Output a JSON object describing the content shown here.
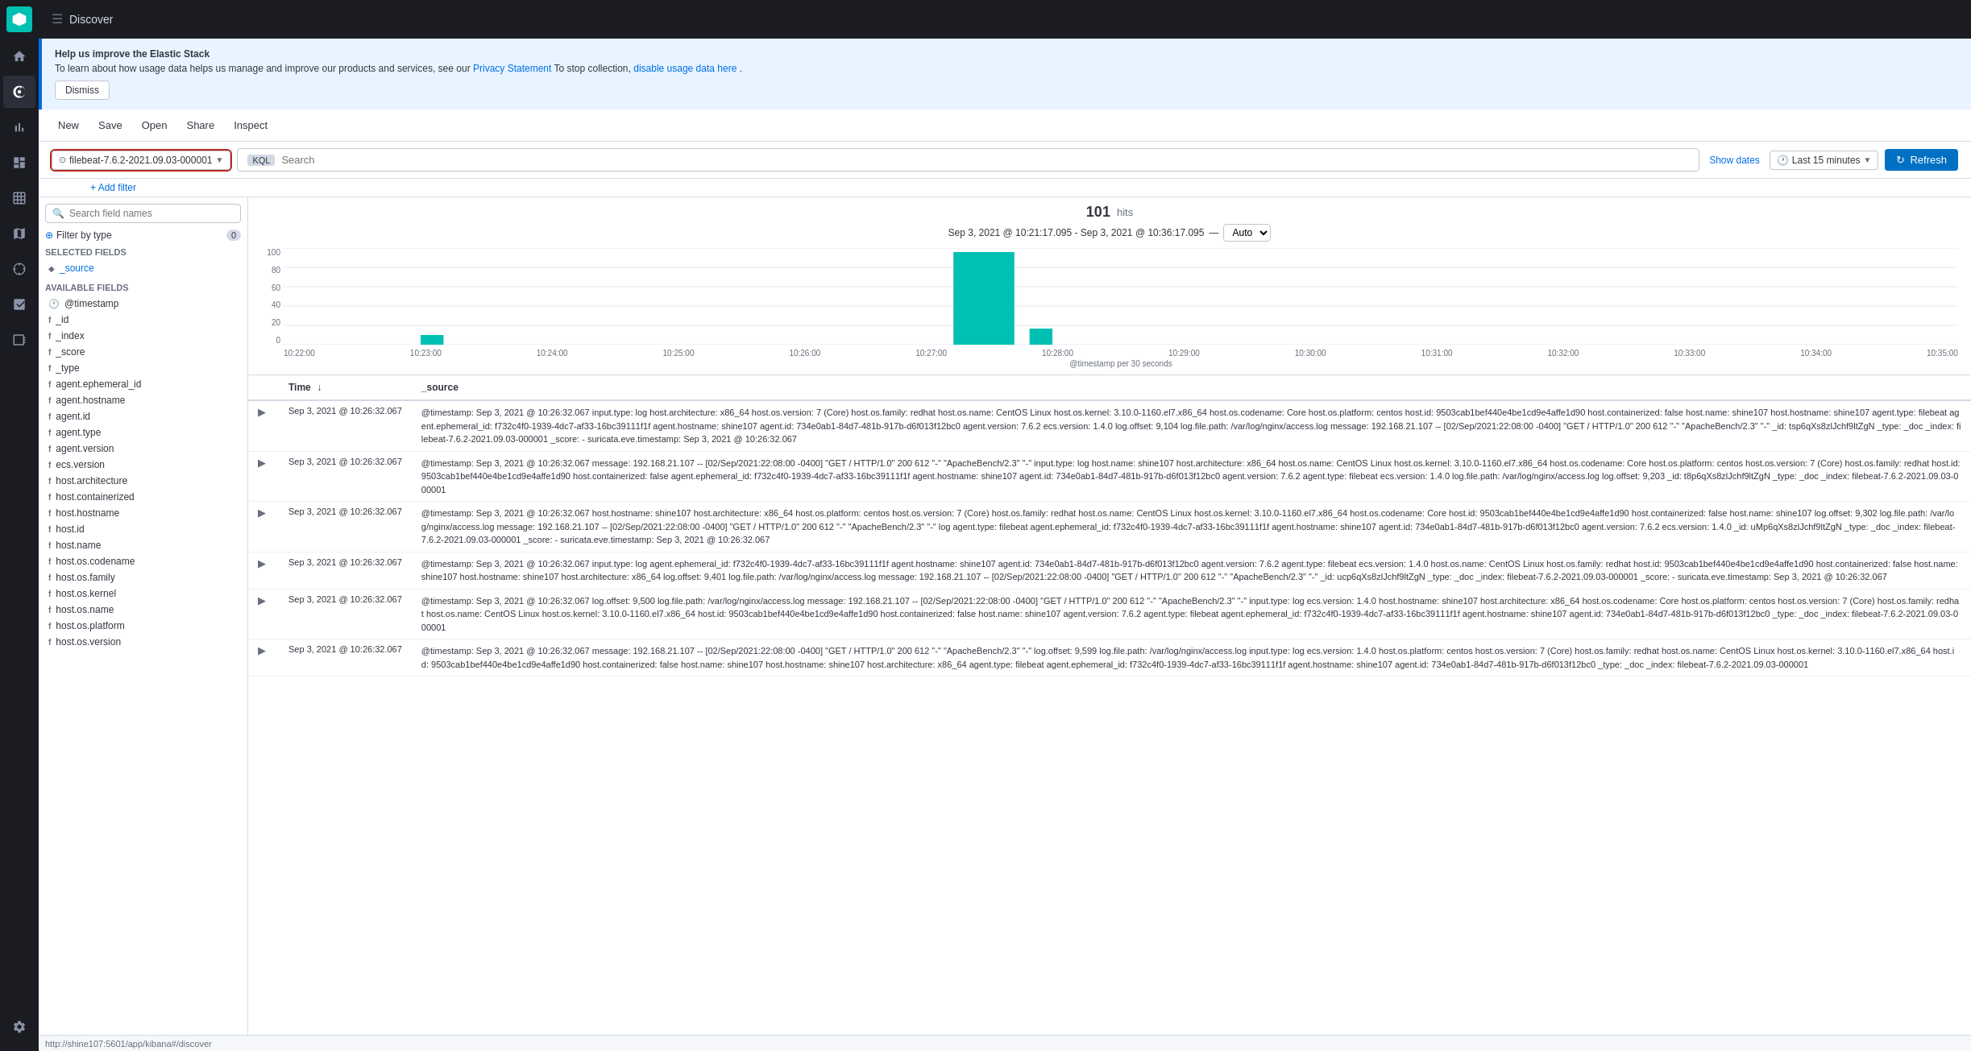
{
  "app": {
    "title": "Discover",
    "logo_text": "K"
  },
  "sidebar": {
    "items": [
      {
        "id": "home",
        "icon": "home",
        "label": "Home"
      },
      {
        "id": "discover",
        "icon": "discover",
        "label": "Discover",
        "active": true
      },
      {
        "id": "visualize",
        "icon": "visualize",
        "label": "Visualize"
      },
      {
        "id": "dashboard",
        "icon": "dashboard",
        "label": "Dashboard"
      },
      {
        "id": "canvas",
        "icon": "canvas",
        "label": "Canvas"
      },
      {
        "id": "maps",
        "icon": "maps",
        "label": "Maps"
      },
      {
        "id": "ml",
        "icon": "ml",
        "label": "Machine Learning"
      },
      {
        "id": "monitoring",
        "icon": "monitoring",
        "label": "Monitoring"
      },
      {
        "id": "settings",
        "icon": "settings",
        "label": "Settings"
      }
    ]
  },
  "banner": {
    "title": "Help us improve the Elastic Stack",
    "text": "To learn about how usage data helps us manage and improve our products and services, see our ",
    "privacy_link_text": "Privacy Statement",
    "stop_text": " To stop collection, ",
    "disable_link_text": "disable usage data here",
    "dismiss_label": "Dismiss"
  },
  "toolbar": {
    "new_label": "New",
    "save_label": "Save",
    "open_label": "Open",
    "share_label": "Share",
    "inspect_label": "Inspect"
  },
  "search": {
    "index_pattern": "filebeat-7.6.2-2021.09.03-000001",
    "placeholder": "Search",
    "kql_label": "KQL",
    "time_picker_label": "Last 15 minutes",
    "show_dates_label": "Show dates",
    "refresh_label": "Refresh",
    "add_filter_label": "+ Add filter"
  },
  "left_panel": {
    "search_placeholder": "Search field names",
    "filter_type_label": "Filter by type",
    "filter_count": "0",
    "selected_fields_title": "Selected fields",
    "available_fields_title": "Available fields",
    "selected_fields": [
      {
        "name": "_source",
        "type": "source"
      }
    ],
    "available_fields": [
      {
        "name": "@timestamp",
        "type": "calendar"
      },
      {
        "name": "_id",
        "type": "string"
      },
      {
        "name": "_index",
        "type": "string"
      },
      {
        "name": "_score",
        "type": "string"
      },
      {
        "name": "_type",
        "type": "string"
      },
      {
        "name": "agent.ephemeral_id",
        "type": "string"
      },
      {
        "name": "agent.hostname",
        "type": "string"
      },
      {
        "name": "agent.id",
        "type": "string"
      },
      {
        "name": "agent.type",
        "type": "string"
      },
      {
        "name": "agent.version",
        "type": "string"
      },
      {
        "name": "ecs.version",
        "type": "string"
      },
      {
        "name": "host.architecture",
        "type": "string"
      },
      {
        "name": "host.containerized",
        "type": "string"
      },
      {
        "name": "host.hostname",
        "type": "string"
      },
      {
        "name": "host.id",
        "type": "string"
      },
      {
        "name": "host.name",
        "type": "string"
      },
      {
        "name": "host.os.codename",
        "type": "string"
      },
      {
        "name": "host.os.family",
        "type": "string"
      },
      {
        "name": "host.os.kernel",
        "type": "string"
      },
      {
        "name": "host.os.name",
        "type": "string"
      },
      {
        "name": "host.os.platform",
        "type": "string"
      },
      {
        "name": "host.os.version",
        "type": "string"
      }
    ]
  },
  "chart": {
    "hits": "101",
    "hits_label": "hits",
    "date_range": "Sep 3, 2021 @ 10:21:17.095 - Sep 3, 2021 @ 10:36:17.095",
    "separator": "—",
    "auto_label": "Auto",
    "x_label": "@timestamp per 30 seconds",
    "y_axis": [
      "100",
      "80",
      "60",
      "40",
      "20",
      "0"
    ],
    "x_ticks": [
      "10:22:00",
      "10:23:00",
      "10:24:00",
      "10:25:00",
      "10:26:00",
      "10:27:00",
      "10:28:00",
      "10:29:00",
      "10:30:00",
      "10:31:00",
      "10:32:00",
      "10:33:00",
      "10:34:00",
      "10:35:00"
    ]
  },
  "table": {
    "col_time": "Time",
    "col_source": "_source",
    "rows": [
      {
        "time": "Sep 3, 2021 @ 10:26:32.067",
        "source": "@timestamp: Sep 3, 2021 @ 10:26:32.067 input.type: log host.architecture: x86_64 host.os.version: 7 (Core) host.os.family: redhat host.os.name: CentOS Linux host.os.kernel: 3.10.0-1160.el7.x86_64 host.os.codename: Core host.os.platform: centos host.id: 9503cab1bef440e4be1cd9e4affe1d90 host.containerized: false host.name: shine107 host.hostname: shine107 agent.type: filebeat agent.ephemeral_id: f732c4f0-1939-4dc7-af33-16bc39111f1f agent.hostname: shine107 agent.id: 734e0ab1-84d7-481b-917b-d6f013f12bc0 agent.version: 7.6.2 ecs.version: 1.4.0 log.offset: 9,104 log.file.path: /var/log/nginx/access.log message: 192.168.21.107 -- [02/Sep/2021:22:08:00 -0400] \"GET / HTTP/1.0\" 200 612 \"-\" \"ApacheBench/2.3\" \"-\" _id: tsp6qXs8zlJchf9ltZgN _type: _doc _index: filebeat-7.6.2-2021.09.03-000001 _score: - suricata.eve.timestamp: Sep 3, 2021 @ 10:26:32.067"
      },
      {
        "time": "Sep 3, 2021 @ 10:26:32.067",
        "source": "@timestamp: Sep 3, 2021 @ 10:26:32.067 message: 192.168.21.107 -- [02/Sep/2021:22:08:00 -0400] \"GET / HTTP/1.0\" 200 612 \"-\" \"ApacheBench/2.3\" \"-\" input.type: log host.name: shine107 host.architecture: x86_64 host.os.name: CentOS Linux host.os.kernel: 3.10.0-1160.el7.x86_64 host.os.codename: Core host.os.platform: centos host.os.version: 7 (Core) host.os.family: redhat host.id: 9503cab1bef440e4be1cd9e4affe1d90 host.containerized: false agent.ephemeral_id: f732c4f0-1939-4dc7-af33-16bc39111f1f agent.hostname: shine107 agent.id: 734e0ab1-84d7-481b-917b-d6f013f12bc0 agent.version: 7.6.2 agent.type: filebeat ecs.version: 1.4.0 log.file.path: /var/log/nginx/access.log log.offset: 9,203 _id: t8p6qXs8zlJchf9ltZgN _type: _doc _index: filebeat-7.6.2-2021.09.03-000001"
      },
      {
        "time": "Sep 3, 2021 @ 10:26:32.067",
        "source": "@timestamp: Sep 3, 2021 @ 10:26:32.067 host.hostname: shine107 host.architecture: x86_64 host.os.platform: centos host.os.version: 7 (Core) host.os.family: redhat host.os.name: CentOS Linux host.os.kernel: 3.10.0-1160.el7.x86_64 host.os.codename: Core host.id: 9503cab1bef440e4be1cd9e4affe1d90 host.containerized: false host.name: shine107 log.offset: 9,302 log.file.path: /var/log/nginx/access.log message: 192.168.21.107 -- [02/Sep/2021:22:08:00 -0400] \"GET / HTTP/1.0\" 200 612 \"-\" \"ApacheBench/2.3\" \"-\" log agent.type: filebeat agent.ephemeral_id: f732c4f0-1939-4dc7-af33-16bc39111f1f agent.hostname: shine107 agent.id: 734e0ab1-84d7-481b-917b-d6f013f12bc0 agent.version: 7.6.2 ecs.version: 1.4.0 _id: uMp6qXs8zlJchf9ltZgN _type: _doc _index: filebeat-7.6.2-2021.09.03-000001 _score: - suricata.eve.timestamp: Sep 3, 2021 @ 10:26:32.067"
      },
      {
        "time": "Sep 3, 2021 @ 10:26:32.067",
        "source": "@timestamp: Sep 3, 2021 @ 10:26:32.067 input.type: log agent.ephemeral_id: f732c4f0-1939-4dc7-af33-16bc39111f1f agent.hostname: shine107 agent.id: 734e0ab1-84d7-481b-917b-d6f013f12bc0 agent.version: 7.6.2 agent.type: filebeat ecs.version: 1.4.0 host.os.name: CentOS Linux host.os.family: redhat host.id: 9503cab1bef440e4be1cd9e4affe1d90 host.containerized: false host.name: shine107 host.hostname: shine107 host.architecture: x86_64 log.offset: 9,401 log.file.path: /var/log/nginx/access.log message: 192.168.21.107 -- [02/Sep/2021:22:08:00 -0400] \"GET / HTTP/1.0\" 200 612 \"-\" \"ApacheBench/2.3\" \"-\" _id: ucp6qXs8zlJchf9ltZgN _type: _doc _index: filebeat-7.6.2-2021.09.03-000001 _score: - suricata.eve.timestamp: Sep 3, 2021 @ 10:26:32.067"
      },
      {
        "time": "Sep 3, 2021 @ 10:26:32.067",
        "source": "@timestamp: Sep 3, 2021 @ 10:26:32.067 log.offset: 9,500 log.file.path: /var/log/nginx/access.log message: 192.168.21.107 -- [02/Sep/2021:22:08:00 -0400] \"GET / HTTP/1.0\" 200 612 \"-\" \"ApacheBench/2.3\" \"-\" input.type: log ecs.version: 1.4.0 host.hostname: shine107 host.architecture: x86_64 host.os.codename: Core host.os.platform: centos host.os.version: 7 (Core) host.os.family: redhat host.os.name: CentOS Linux host.os.kernel: 3.10.0-1160.el7.x86_64 host.id: 9503cab1bef440e4be1cd9e4affe1d90 host.containerized: false host.name: shine107 agent.version: 7.6.2 agent.type: filebeat agent.ephemeral_id: f732c4f0-1939-4dc7-af33-16bc39111f1f agent.hostname: shine107 agent.id: 734e0ab1-84d7-481b-917b-d6f013f12bc0 _type: _doc _index: filebeat-7.6.2-2021.09.03-000001"
      },
      {
        "time": "Sep 3, 2021 @ 10:26:32.067",
        "source": "@timestamp: Sep 3, 2021 @ 10:26:32.067 message: 192.168.21.107 -- [02/Sep/2021:22:08:00 -0400] \"GET / HTTP/1.0\" 200 612 \"-\" \"ApacheBench/2.3\" \"-\" log.offset: 9,599 log.file.path: /var/log/nginx/access.log input.type: log ecs.version: 1.4.0 host.os.platform: centos host.os.version: 7 (Core) host.os.family: redhat host.os.name: CentOS Linux host.os.kernel: 3.10.0-1160.el7.x86_64 host.id: 9503cab1bef440e4be1cd9e4affe1d90 host.containerized: false host.name: shine107 host.hostname: shine107 host.architecture: x86_64 agent.type: filebeat agent.ephemeral_id: f732c4f0-1939-4dc7-af33-16bc39111f1f agent.hostname: shine107 agent.id: 734e0ab1-84d7-481b-917b-d6f013f12bc0 _type: _doc _index: filebeat-7.6.2-2021.09.03-000001"
      }
    ]
  },
  "status_bar": {
    "url": "http://shine107:5601/app/kibana#/discover"
  }
}
